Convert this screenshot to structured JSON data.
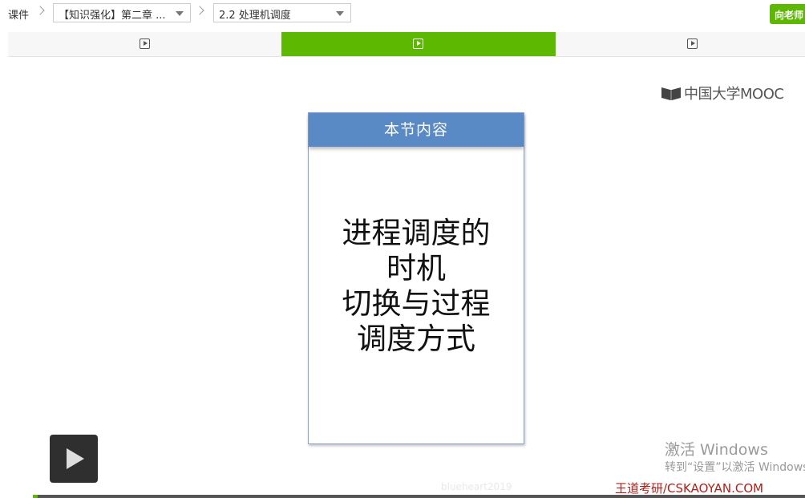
{
  "breadcrumb": {
    "root": "课件",
    "chapter_select": "【知识强化】第二章 ...",
    "section_select": "2.2 处理机调度"
  },
  "ask_button": "向老师",
  "tabs": [
    {
      "icon": "play-icon",
      "active": false
    },
    {
      "icon": "play-icon",
      "active": true
    },
    {
      "icon": "play-icon",
      "active": false
    }
  ],
  "video": {
    "logo_text": "中国大学MOOC",
    "slide": {
      "header": "本节内容",
      "lines": [
        "进程调度的",
        "时机",
        "切换与过程",
        "调度方式"
      ]
    },
    "watermarks": {
      "windows_title": "激活 Windows",
      "windows_sub": "转到“设置”以激活 Windows",
      "user": "blueheart2019",
      "site": "王道考研/CSKAOYAN.COM"
    },
    "progress": 0.006
  },
  "colors": {
    "accent": "#5cb800",
    "slide_header": "#5a8ac6",
    "site_watermark": "#b0201a"
  }
}
